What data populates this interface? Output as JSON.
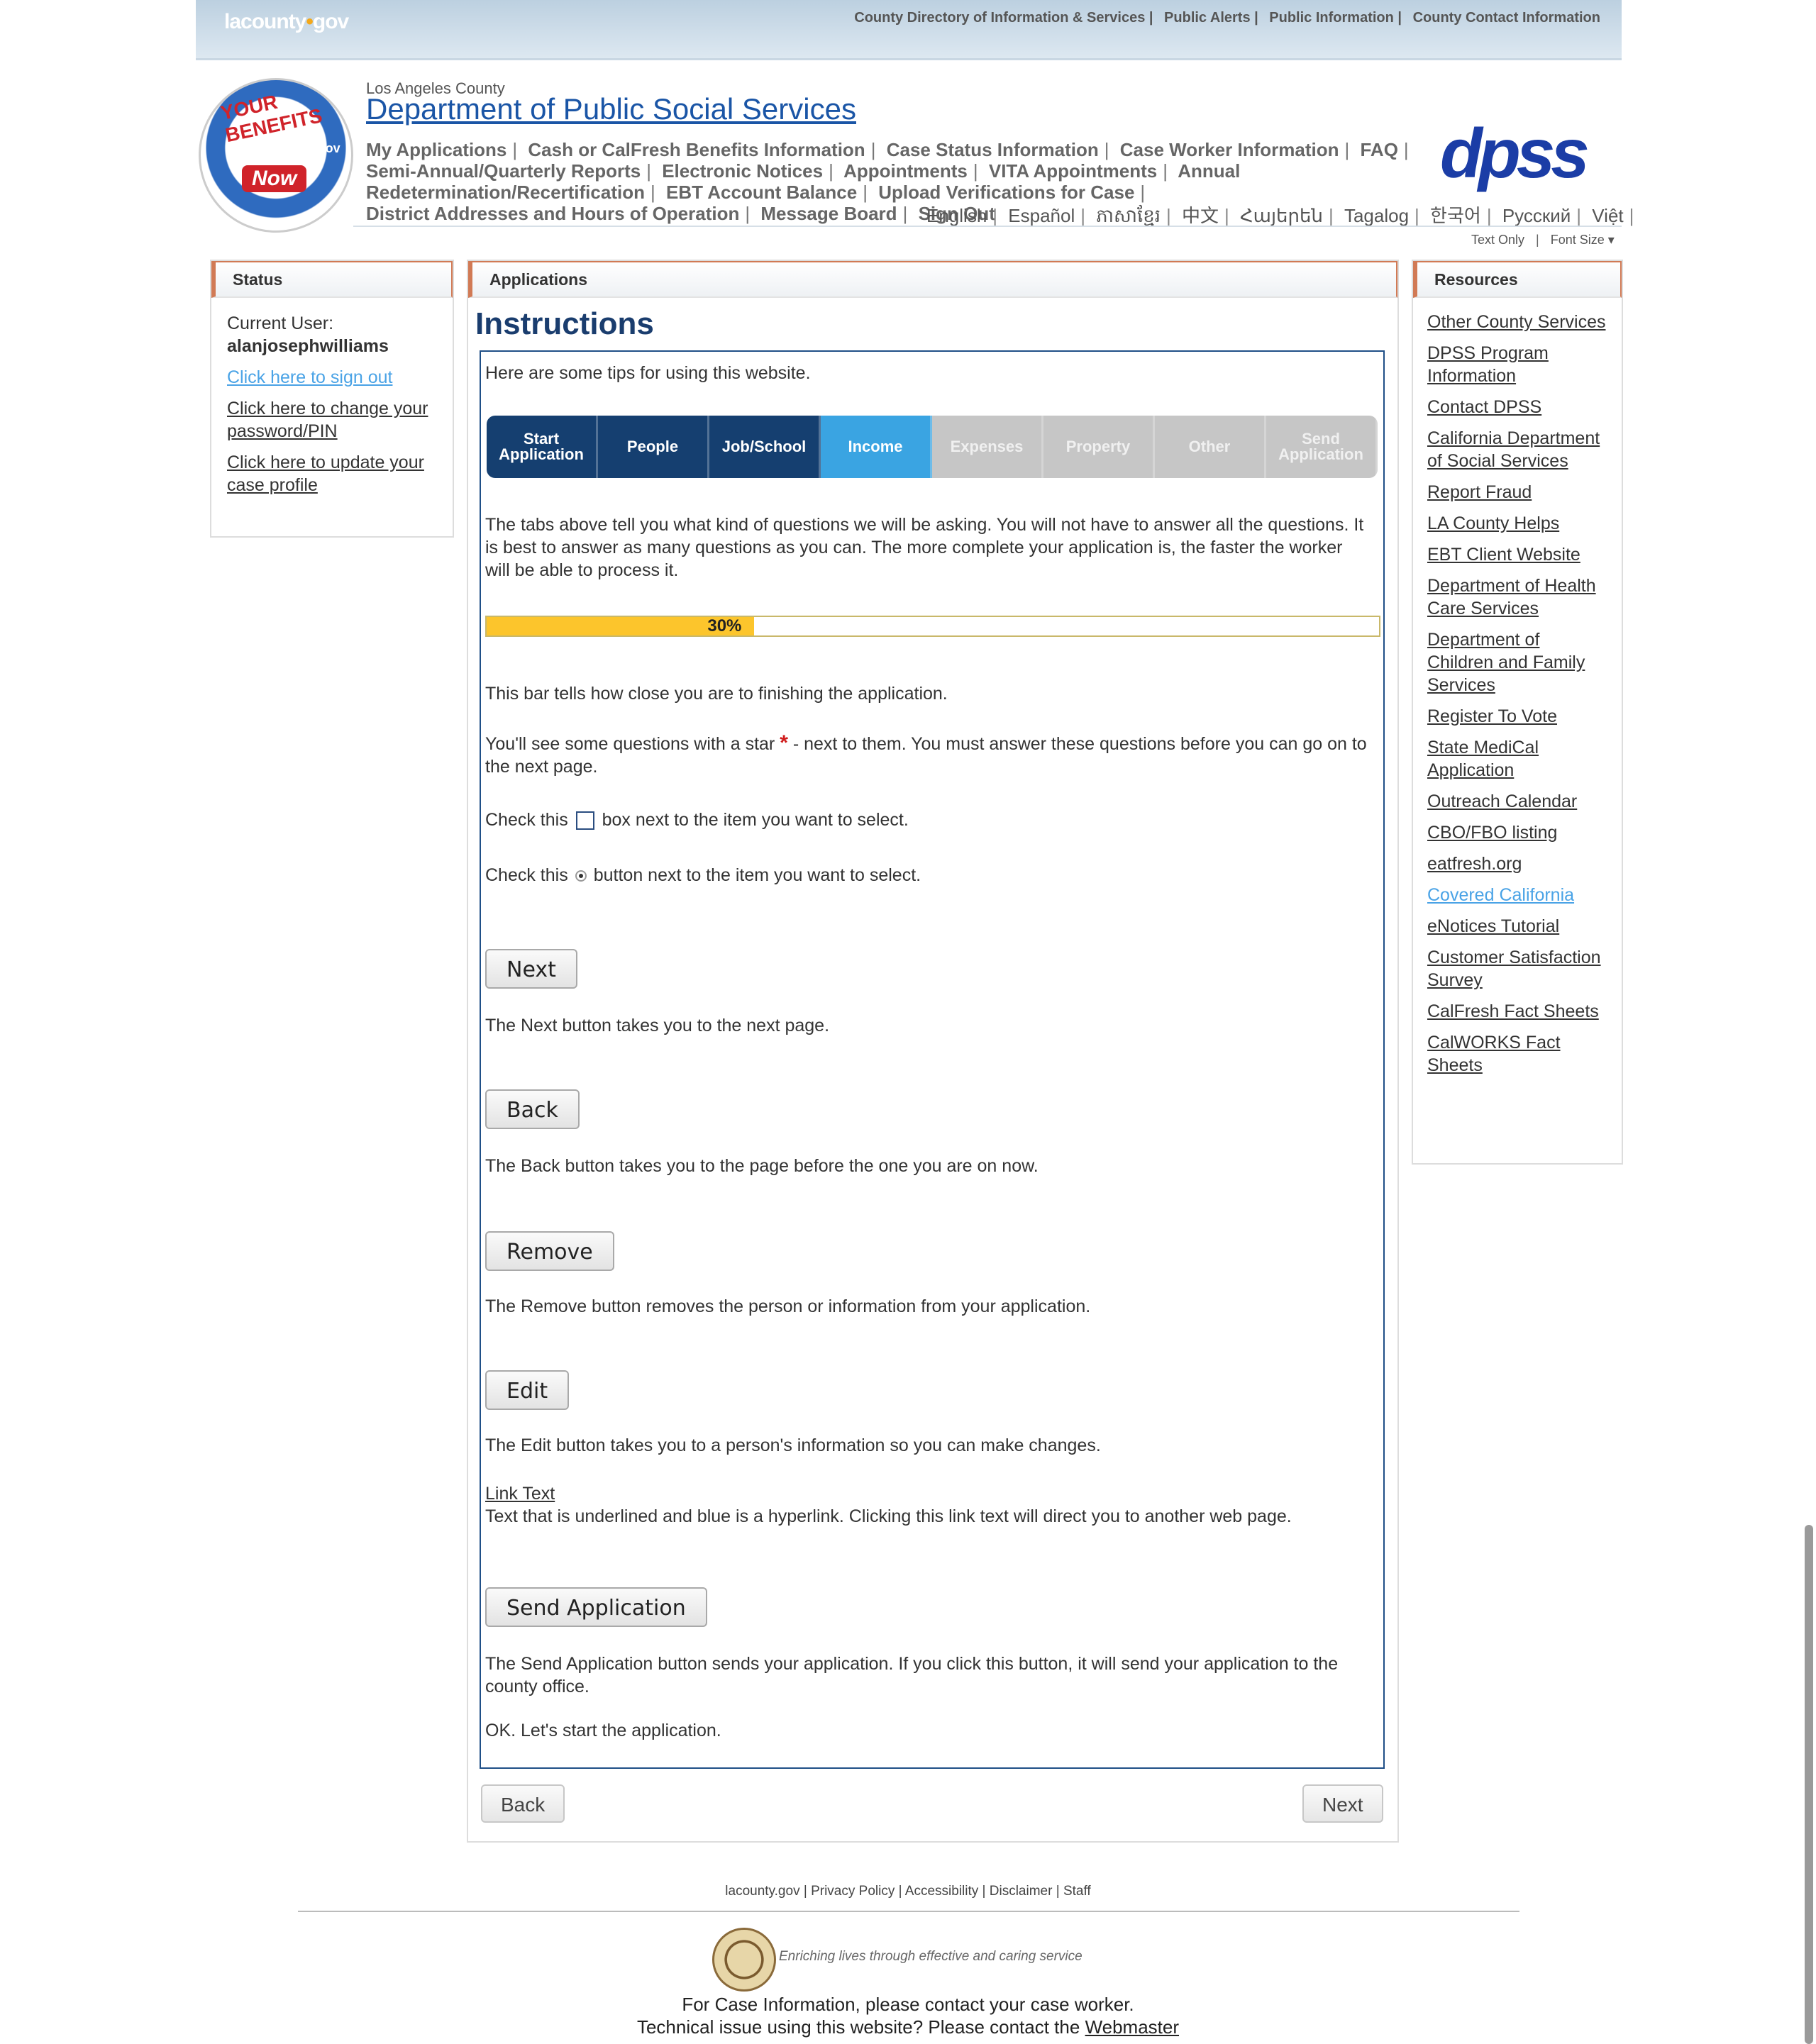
{
  "topbar": {
    "logo_text": "lacounty",
    "logo_dot": "•",
    "logo_suffix": "gov",
    "links": [
      "County Directory of Information & Services |",
      "Public Alerts |",
      "Public Information |",
      "County Contact Information"
    ]
  },
  "header": {
    "badge_line1": "YOUR BENEFITS",
    "badge_line2": "dpss.lacounty.gov",
    "badge_line3": "Now",
    "county": "Los Angeles County",
    "department": "Department of Public Social Services",
    "dpss_logo": "dpss"
  },
  "mainnav": [
    "My Applications",
    "Cash or CalFresh Benefits Information",
    "Case Status Information",
    "Case Worker Information",
    "FAQ",
    "Semi-Annual/Quarterly Reports",
    "Electronic Notices",
    "Appointments",
    "VITA Appointments",
    "Annual Redetermination/Recertification",
    "EBT Account Balance",
    "Upload Verifications for Case",
    "District Addresses and Hours of Operation",
    "Message Board",
    "Sign Out"
  ],
  "languages": [
    "English",
    "Español",
    "ភាសាខ្មែរ",
    "中文",
    "Հայերեն",
    "Tagalog",
    "한국어",
    "Русский",
    "Việt"
  ],
  "text_size": {
    "text_only": "Text Only",
    "font_size": "Font Size"
  },
  "status": {
    "title": "Status",
    "current_user_label": "Current User:",
    "current_user": "alanjosephwilliams",
    "sign_out": "Click here to sign out",
    "change_password": "Click here to change your password/PIN",
    "update_profile": "Click here to update your case profile"
  },
  "applications": {
    "title": "Applications",
    "heading": "Instructions",
    "tips": "Here are some tips for using this website.",
    "tabs": [
      {
        "label": "Start Application",
        "state": "done"
      },
      {
        "label": "People",
        "state": "done"
      },
      {
        "label": "Job/School",
        "state": "done"
      },
      {
        "label": "Income",
        "state": "active"
      },
      {
        "label": "Expenses",
        "state": "todo"
      },
      {
        "label": "Property",
        "state": "todo"
      },
      {
        "label": "Other",
        "state": "todo"
      },
      {
        "label": "Send Application",
        "state": "todo"
      }
    ],
    "tabs_text": "The tabs above tell you what kind of questions we will be asking. You will not have to answer all the questions. It is best to answer as many questions as you can. The more complete your application is, the faster the worker will be able to process it.",
    "progress_label": "30%",
    "progress_value": 0.3,
    "progress_text": "This bar tells how close you are to finishing the application.",
    "star_text_before": "You'll see some questions with a star",
    "star_symbol": "*",
    "star_text_after": "- next to them. You must answer these questions before you can go on to the next page.",
    "checkbox_before": "Check this",
    "checkbox_after": "box next to the item you want to select.",
    "radio_before": "Check this",
    "radio_after": "button next to the item you want to select.",
    "next_label": "Next",
    "next_text": "The Next button takes you to the next page.",
    "back_label": "Back",
    "back_text": "The Back button takes you to the page before the one you are on now.",
    "remove_label": "Remove",
    "remove_text": "The Remove button removes the person or information from your application.",
    "edit_label": "Edit",
    "edit_text": "The Edit button takes you to a person's information so you can make changes.",
    "link_label": "Link Text",
    "link_text": "Text that is underlined and blue is a hyperlink. Clicking this link text will direct you to another web page.",
    "send_label": "Send Application",
    "send_text": "The Send Application button sends your application. If you click this button, it will send your application to the county office.",
    "ok_text": "OK. Let's start the application.",
    "nav_back": "Back",
    "nav_next": "Next"
  },
  "resources": {
    "title": "Resources",
    "links": [
      "Other County Services",
      "DPSS Program Information",
      "Contact DPSS",
      "California Department of Social Services",
      "Report Fraud",
      "LA County Helps",
      "EBT Client Website",
      "Department of Health Care Services",
      "Department of Children and Family Services",
      "Register To Vote",
      "State MediCal Application",
      "Outreach Calendar",
      "CBO/FBO listing",
      "eatfresh.org",
      "Covered California",
      "eNotices Tutorial",
      "Customer Satisfaction Survey",
      "CalFresh Fact Sheets",
      "CalWORKS Fact Sheets"
    ]
  },
  "footer": {
    "links": [
      "lacounty.gov",
      "Privacy Policy",
      "Accessibility",
      "Disclaimer",
      "Staff"
    ],
    "tagline": "Enriching lives through effective and caring service",
    "case_info": "For Case Information, please contact your case worker.",
    "tech_issue": "Technical issue using this website? Please contact the",
    "webmaster": "Webmaster"
  }
}
